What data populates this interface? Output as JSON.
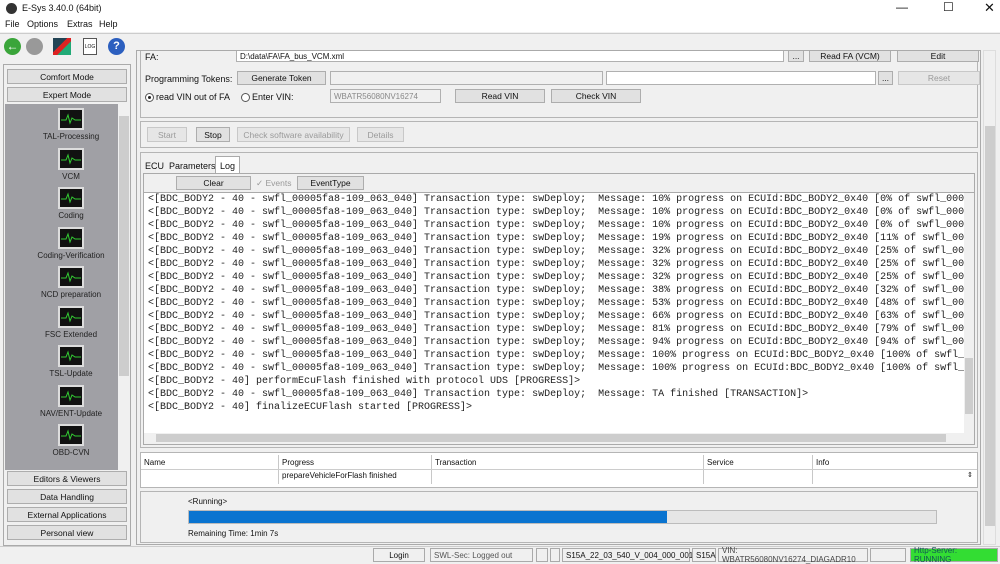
{
  "window": {
    "title": "E-Sys 3.40.0  (64bit)"
  },
  "menu": [
    "File",
    "Options",
    "Extras",
    "Help"
  ],
  "toolbar": {
    "icons": [
      "back-icon",
      "forward-icon",
      "connect-icon",
      "log-icon",
      "help-icon"
    ]
  },
  "sidebar": {
    "top_buttons": [
      "Comfort Mode",
      "Expert Mode"
    ],
    "items": [
      "TAL-Processing",
      "VCM",
      "Coding",
      "Coding-Verification",
      "NCD preparation",
      "FSC Extended",
      "TSL-Update",
      "NAV/ENT-Update",
      "OBD-CVN"
    ],
    "bottom_buttons": [
      "Editors & Viewers",
      "Data Handling",
      "External Applications",
      "Personal view"
    ]
  },
  "fa_panel": {
    "fa_label": "FA:",
    "fa_value": "D:\\data\\FA\\FA_bus_VCM.xml",
    "fa_browse": "...",
    "read_fa": "Read FA (VCM)",
    "edit": "Edit",
    "tokens_label": "Programming Tokens:",
    "generate_token": "Generate Token",
    "token_browse": "...",
    "reset": "Reset",
    "radio_read_vin": "read VIN out of FA",
    "radio_enter_vin": "Enter VIN:",
    "vin_value": "WBATR56080NV16274",
    "read_vin": "Read VIN",
    "check_vin": "Check VIN"
  },
  "actions": {
    "start": "Start",
    "stop": "Stop",
    "check_sw": "Check software availability",
    "details": "Details"
  },
  "tabs": [
    "ECU",
    "Parameters",
    "Log"
  ],
  "log": {
    "clear": "Clear",
    "events": "Events",
    "event_type": "EventType",
    "lines": [
      "<[BDC_BODY2 - 40 - swfl_00005fa8-109_063_040] Transaction type: swDeploy;  Message: 10% progress on ECUId:BDC_BODY2_0x40 [0% of swfl_00005fa",
      "<[BDC_BODY2 - 40 - swfl_00005fa8-109_063_040] Transaction type: swDeploy;  Message: 10% progress on ECUId:BDC_BODY2_0x40 [0% of swfl_00005fa",
      "<[BDC_BODY2 - 40 - swfl_00005fa8-109_063_040] Transaction type: swDeploy;  Message: 10% progress on ECUId:BDC_BODY2_0x40 [0% of swfl_00005fa",
      "<[BDC_BODY2 - 40 - swfl_00005fa8-109_063_040] Transaction type: swDeploy;  Message: 19% progress on ECUId:BDC_BODY2_0x40 [11% of swfl_00005f",
      "<[BDC_BODY2 - 40 - swfl_00005fa8-109_063_040] Transaction type: swDeploy;  Message: 32% progress on ECUId:BDC_BODY2_0x40 [25% of swfl_00005f",
      "<[BDC_BODY2 - 40 - swfl_00005fa8-109_063_040] Transaction type: swDeploy;  Message: 32% progress on ECUId:BDC_BODY2_0x40 [25% of swfl_00005f",
      "<[BDC_BODY2 - 40 - swfl_00005fa8-109_063_040] Transaction type: swDeploy;  Message: 32% progress on ECUId:BDC_BODY2_0x40 [25% of swfl_00005f",
      "<[BDC_BODY2 - 40 - swfl_00005fa8-109_063_040] Transaction type: swDeploy;  Message: 38% progress on ECUId:BDC_BODY2_0x40 [32% of swfl_00005f",
      "<[BDC_BODY2 - 40 - swfl_00005fa8-109_063_040] Transaction type: swDeploy;  Message: 53% progress on ECUId:BDC_BODY2_0x40 [48% of swfl_00005f",
      "<[BDC_BODY2 - 40 - swfl_00005fa8-109_063_040] Transaction type: swDeploy;  Message: 66% progress on ECUId:BDC_BODY2_0x40 [63% of swfl_00005f",
      "<[BDC_BODY2 - 40 - swfl_00005fa8-109_063_040] Transaction type: swDeploy;  Message: 81% progress on ECUId:BDC_BODY2_0x40 [79% of swfl_00005f",
      "<[BDC_BODY2 - 40 - swfl_00005fa8-109_063_040] Transaction type: swDeploy;  Message: 94% progress on ECUId:BDC_BODY2_0x40 [94% of swfl_00005f",
      "<[BDC_BODY2 - 40 - swfl_00005fa8-109_063_040] Transaction type: swDeploy;  Message: 100% progress on ECUId:BDC_BODY2_0x40 [100% of swfl_0000",
      "<[BDC_BODY2 - 40 - swfl_00005fa8-109_063_040] Transaction type: swDeploy;  Message: 100% progress on ECUId:BDC_BODY2_0x40 [100% of swfl_0000",
      "<[BDC_BODY2 - 40] performEcuFlash finished with protocol UDS [PROGRESS]>",
      "<[BDC_BODY2 - 40 - swfl_00005fa8-109_063_040] Transaction type: swDeploy;  Message: TA finished [TRANSACTION]>",
      "<[BDC_BODY2 - 40] finalizeECUFlash started [PROGRESS]>"
    ]
  },
  "table": {
    "headers": [
      "Name",
      "Progress",
      "Transaction",
      "Service",
      "Info"
    ],
    "rows": [
      [
        "",
        "prepareVehicleForFlash finished",
        "",
        "",
        ""
      ]
    ]
  },
  "progress": {
    "status": "<Running>",
    "percent": 64,
    "remaining": "Remaining Time:  1min 7s",
    "color": "#0a74d0"
  },
  "statusbar": {
    "login": "Login",
    "swl": "SWL-Sec: Logged out",
    "istep": "S15A_22_03_540_V_004_000_001",
    "series": "S15A",
    "vin": "VIN: WBATR56080NV16274_DIAGADR10",
    "http": "Http-Server: RUNNING",
    "http_color": "#33dd33"
  }
}
